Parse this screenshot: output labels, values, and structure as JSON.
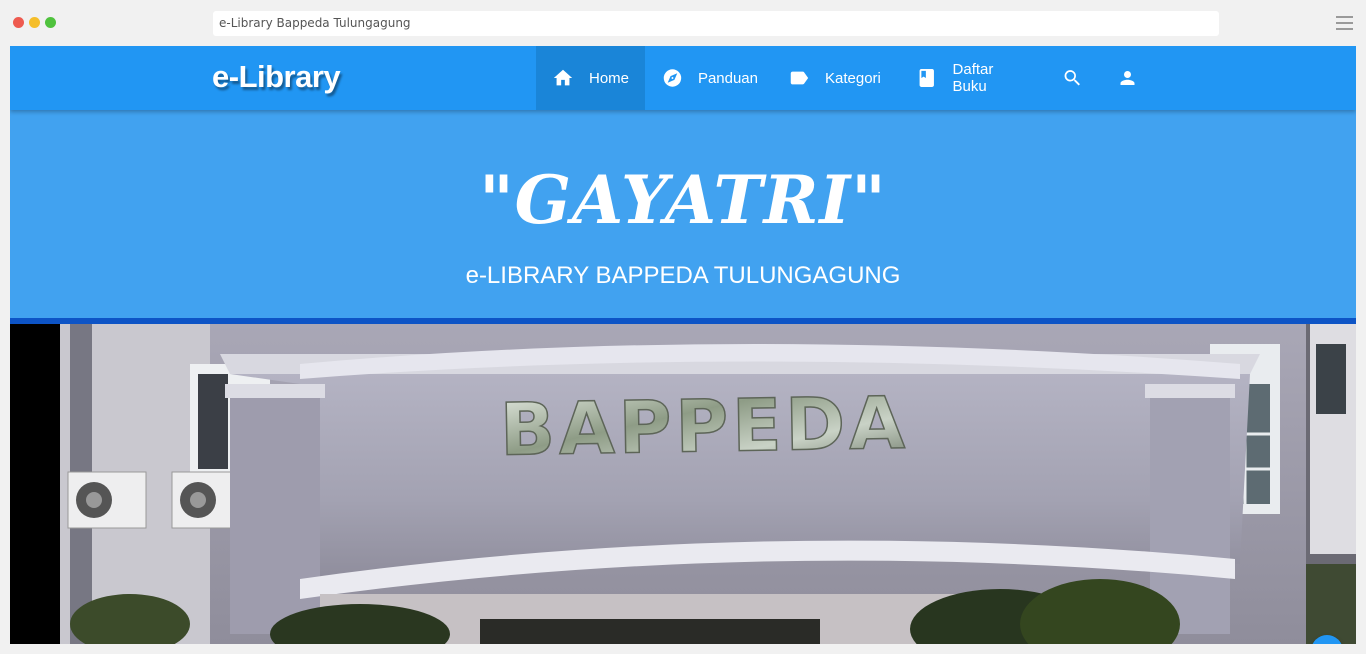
{
  "browser": {
    "url_text": "e-Library Bappeda Tulungagung"
  },
  "navbar": {
    "brand": "e-Library",
    "items": [
      {
        "label": "Home",
        "icon": "home-icon",
        "active": true
      },
      {
        "label": "Panduan",
        "icon": "compass-icon"
      },
      {
        "label": "Kategori",
        "icon": "label-icon"
      },
      {
        "label": "Daftar Buku",
        "icon": "book-icon"
      }
    ],
    "search_icon": "search-icon",
    "user_icon": "user-icon"
  },
  "hero": {
    "title": "\"GAYATRI\"",
    "subtitle": "e-LIBRARY BAPPEDA TULUNGAGUNG"
  },
  "banner": {
    "sign_text": "BAPPEDA"
  },
  "colors": {
    "navbar": "#2196f3",
    "hero": "#41a2f0",
    "hero_border": "#0d54c6"
  }
}
